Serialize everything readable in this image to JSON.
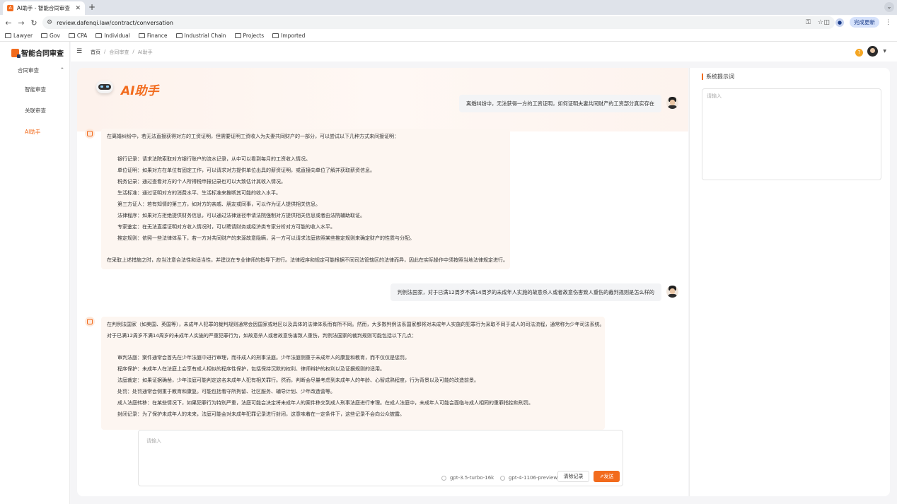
{
  "browser": {
    "tab_title": "AI助手 - 智能合同审查",
    "tab_close": "✕",
    "new_tab": "+",
    "url": "review.dafenqi.law/contract/conversation",
    "update_label": "完成更新",
    "bookmarks": [
      "Lawyer",
      "Gov",
      "CPA",
      "Individual",
      "Finance",
      "Industrial Chain",
      "Projects",
      "Imported"
    ]
  },
  "app": {
    "logo_text": "智能合同审查",
    "sidebar": {
      "group_label": "合同审查",
      "items": [
        "智能审查",
        "关联审查",
        "AI助手"
      ]
    },
    "breadcrumb": [
      "首页",
      "合同审查",
      "AI助手"
    ],
    "breadcrumb_sep": "/",
    "help": "?"
  },
  "chat": {
    "title": "AI助手",
    "messages": [
      {
        "role": "user",
        "text": "离婚纠纷中，无法获得一方的工资证明，如何证明夫妻共同财产的工资部分真实存在"
      },
      {
        "role": "assistant",
        "lines": [
          "在离婚纠纷中，若无法直接获得对方的工资证明，但需要证明工资收入为夫妻共同财产的一部分，可以尝试以下几种方式来间接证明：",
          "银行记录：请求法院索取对方银行账户的流水记录，从中可以看到每月的工资收入情况。",
          "单位证明：如果对方在单位有固定工作，可以请求对方提供单位出具的薪资证明，或直接向单位了解并获取薪资信息。",
          "税务记录：通过查看对方的个人所得税申报记录也可以大致估计其收入情况。",
          "生活标准：通过证明对方的消费水平、生活标准来推断其可能的收入水平。",
          "第三方证人：若有知情的第三方，如对方的亲戚、朋友或同事，可以作为证人提供相关信息。",
          "法律程序：如果对方拒绝提供财务信息，可以通过法律途径申请法院强制对方提供相关信息或者由法院辅助取证。",
          "专家鉴定：在无法直接证明对方收入情况时，可以聘请财务或经济类专家分析对方可能的收入水平。",
          "推定规则：依照一些法律体系下，若一方对共同财产的来源故意隐瞒，另一方可以请求法庭依照某些推定规则来确定财产的性质与分配。",
          "在采取上述措施之时，应当注意合法性和适当性，并建议在专业律师的指导下进行。法律程序和规定可能根据不同司法管辖区的法律而异，因此在实际操作中须按照当地法律规定进行。"
        ]
      },
      {
        "role": "user",
        "text": "判例法国家，对于已满12周岁不满14周岁的未成年人实施的故意杀人或者故意伤害致人重伤的裁判规则是怎么样的"
      },
      {
        "role": "assistant",
        "lines": [
          "在判例法国家（如美国、英国等），未成年人犯罪的裁判规则通常会因国家或地区以及具体的法律体系而有所不同。然而，大多数判例法系国家都将对未成年人实施的犯罪行为采取不同于成人的司法流程，通常称为少年司法系统。",
          "对于已满12周岁不满14周岁的未成年人实施的严重犯罪行为，如故意杀人或者故意伤害致人重伤，判例法国家的裁判规则可能包括以下几点：",
          "审判法庭：案件通常会首先在少年法庭中进行审理，而非成人的刑事法庭。少年法庭侧重于未成年人的康复和教育，而不仅仅是惩罚。",
          "程序保护：未成年人在法庭上会享有成人相似的程序性保护，包括保持沉默的权利、律师辩护的权利以及证据规则的适用。",
          "法庭裁定：如果证据确凿，少年法庭可能判定这名未成年人犯有相关罪行。然而，判断会尽量考虑到未成年人的年龄、心智成熟程度，行为背景以及可能的改造前景。",
          "处罚：处罚通常会侧重于教育和康复。可能包括看守所拘留、社区服务、辅导计划、少年改造营等。",
          "成人法庭转移：在某些情况下，如果犯罪行为特别严重，法庭可能会决定将未成年人的案件移交到成人刑事法庭进行审理。在成人法庭中，未成年人可能会面临与成人相同的重罪指控和刑罚。",
          "封闭记录：为了保护未成年人的未来，法庭可能会对未成年犯罪记录进行封闭，这意味着在一定条件下，这些记录不会向公众披露。"
        ]
      }
    ],
    "input_placeholder": "请输入",
    "models": [
      "gpt-3.5-turbo-16k",
      "gpt-4-1106-preview"
    ],
    "clear_label": "清除记录",
    "send_label": "发送"
  },
  "panel": {
    "title": "系统提示词",
    "placeholder": "请输入"
  },
  "colors": {
    "accent": "#f26b1d"
  }
}
